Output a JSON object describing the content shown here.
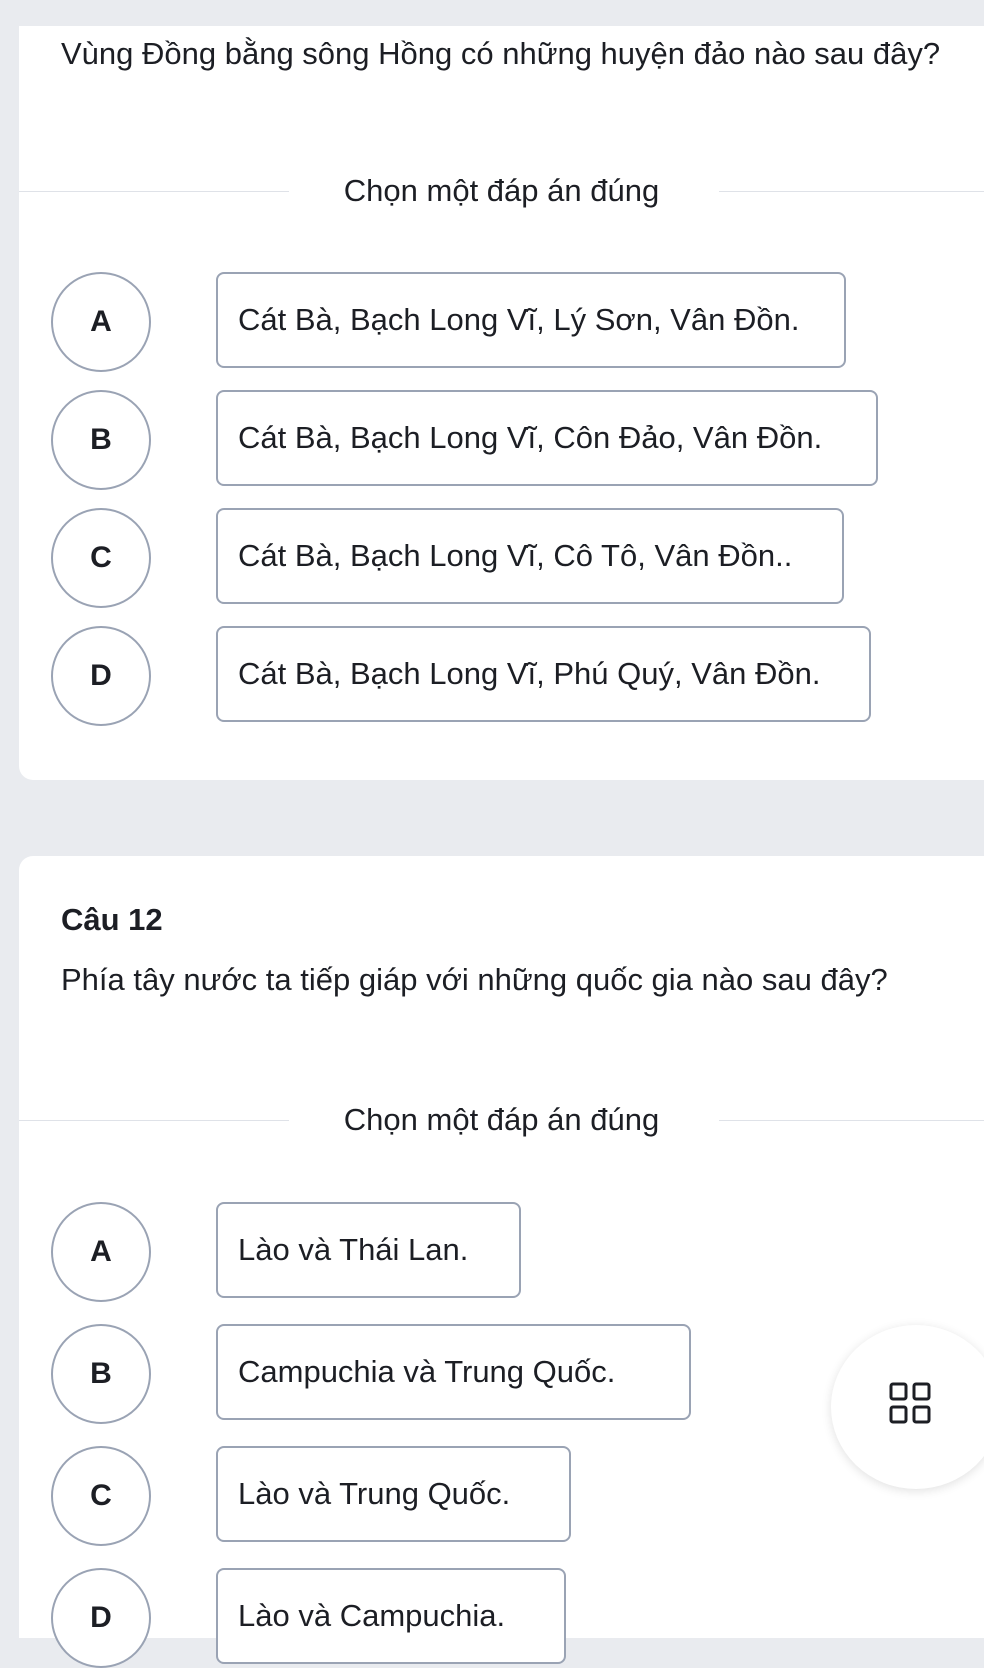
{
  "question1": {
    "text": "Vùng Đồng bằng sông Hồng có những huyện đảo nào sau đây?",
    "prompt": "Chọn một đáp án đúng",
    "options": [
      {
        "letter": "A",
        "text": "Cát Bà, Bạch Long Vĩ, Lý Sơn, Vân Đồn."
      },
      {
        "letter": "B",
        "text": "Cát Bà, Bạch Long Vĩ, Côn Đảo, Vân Đồn."
      },
      {
        "letter": "C",
        "text": "Cát Bà, Bạch Long Vĩ, Cô Tô, Vân Đồn.."
      },
      {
        "letter": "D",
        "text": "Cát Bà, Bạch Long Vĩ, Phú Quý, Vân Đồn."
      }
    ]
  },
  "question2": {
    "number": "Câu 12",
    "text": "Phía tây nước ta tiếp giáp với những quốc gia nào sau đây?",
    "prompt": "Chọn một đáp án đúng",
    "options": [
      {
        "letter": "A",
        "text": "Lào và Thái Lan."
      },
      {
        "letter": "B",
        "text": "Campuchia và Trung Quốc."
      },
      {
        "letter": "C",
        "text": "Lào và Trung Quốc."
      },
      {
        "letter": "D",
        "text": "Lào và Campuchia."
      }
    ]
  },
  "fab": {
    "icon": "grid-icon"
  }
}
